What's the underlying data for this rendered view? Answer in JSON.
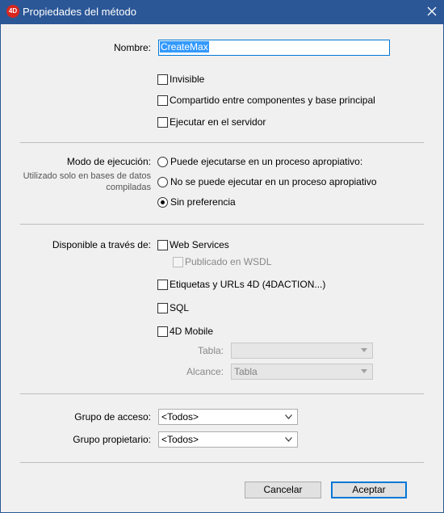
{
  "window": {
    "title": "Propiedades del método",
    "app_icon": "4D"
  },
  "name": {
    "label": "Nombre:",
    "value": "CreateMax"
  },
  "attributes": {
    "invisible": {
      "label": "Invisible",
      "checked": false
    },
    "shared": {
      "label": "Compartido entre componentes y base principal",
      "checked": false
    },
    "server": {
      "label": "Ejecutar en el servidor",
      "checked": false
    }
  },
  "execution": {
    "label": "Modo de ejecución:",
    "note": "Utilizado solo en bases de datos compiladas",
    "options": [
      {
        "label": "Puede ejecutarse en un proceso apropiativo:",
        "selected": false
      },
      {
        "label": "No se puede ejecutar en un proceso apropiativo",
        "selected": false
      },
      {
        "label": "Sin preferencia",
        "selected": true
      }
    ]
  },
  "available": {
    "label": "Disponible a través de:",
    "web_services": {
      "label": "Web Services",
      "checked": false
    },
    "wsdl": {
      "label": "Publicado en WSDL",
      "checked": false,
      "enabled": false
    },
    "tags": {
      "label": "Etiquetas y URLs 4D (4DACTION...)",
      "checked": false
    },
    "sql": {
      "label": "SQL",
      "checked": false
    },
    "mobile": {
      "label": "4D Mobile",
      "checked": false
    },
    "tabla": {
      "label": "Tabla:",
      "value": ""
    },
    "alcance": {
      "label": "Alcance:",
      "value": "Tabla"
    }
  },
  "groups": {
    "access": {
      "label": "Grupo de acceso:",
      "value": "<Todos>"
    },
    "owner": {
      "label": "Grupo propietario:",
      "value": "<Todos>"
    }
  },
  "buttons": {
    "cancel": "Cancelar",
    "ok": "Aceptar"
  },
  "colors": {
    "titlebar": "#2b5797",
    "selection": "#3399ff",
    "default_button_border": "#0078d7"
  }
}
